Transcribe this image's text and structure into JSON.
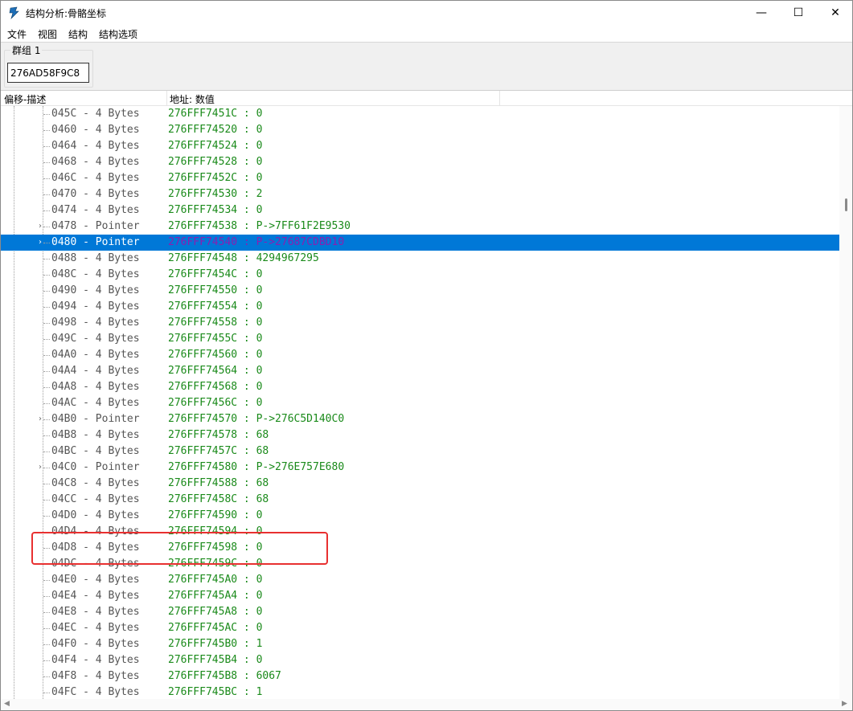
{
  "window": {
    "title": "结构分析:骨骼坐标",
    "min_glyph": "—",
    "max_glyph": "☐",
    "close_glyph": "✕"
  },
  "menu": [
    "文件",
    "视图",
    "结构",
    "结构选项"
  ],
  "group": {
    "label": "群组 1",
    "address": "276AD58F9C8"
  },
  "columns": {
    "offset_desc": "偏移-描述",
    "address_value": "地址: 数值"
  },
  "rows": [
    {
      "offset_desc": "045C - 4 Bytes",
      "address_value": "276FFF7451C : 0",
      "expandable": false,
      "selected": false
    },
    {
      "offset_desc": "0460 - 4 Bytes",
      "address_value": "276FFF74520 : 0",
      "expandable": false,
      "selected": false
    },
    {
      "offset_desc": "0464 - 4 Bytes",
      "address_value": "276FFF74524 : 0",
      "expandable": false,
      "selected": false
    },
    {
      "offset_desc": "0468 - 4 Bytes",
      "address_value": "276FFF74528 : 0",
      "expandable": false,
      "selected": false
    },
    {
      "offset_desc": "046C - 4 Bytes",
      "address_value": "276FFF7452C : 0",
      "expandable": false,
      "selected": false
    },
    {
      "offset_desc": "0470 - 4 Bytes",
      "address_value": "276FFF74530 : 2",
      "expandable": false,
      "selected": false
    },
    {
      "offset_desc": "0474 - 4 Bytes",
      "address_value": "276FFF74534 : 0",
      "expandable": false,
      "selected": false
    },
    {
      "offset_desc": "0478 - Pointer",
      "address_value": "276FFF74538 : P->7FF61F2E9530",
      "expandable": true,
      "selected": false
    },
    {
      "offset_desc": "0480 - Pointer",
      "address_value": "276FFF74540 : P->27687CDBD10",
      "expandable": true,
      "selected": true
    },
    {
      "offset_desc": "0488 - 4 Bytes",
      "address_value": "276FFF74548 : 4294967295",
      "expandable": false,
      "selected": false
    },
    {
      "offset_desc": "048C - 4 Bytes",
      "address_value": "276FFF7454C : 0",
      "expandable": false,
      "selected": false
    },
    {
      "offset_desc": "0490 - 4 Bytes",
      "address_value": "276FFF74550 : 0",
      "expandable": false,
      "selected": false
    },
    {
      "offset_desc": "0494 - 4 Bytes",
      "address_value": "276FFF74554 : 0",
      "expandable": false,
      "selected": false
    },
    {
      "offset_desc": "0498 - 4 Bytes",
      "address_value": "276FFF74558 : 0",
      "expandable": false,
      "selected": false
    },
    {
      "offset_desc": "049C - 4 Bytes",
      "address_value": "276FFF7455C : 0",
      "expandable": false,
      "selected": false
    },
    {
      "offset_desc": "04A0 - 4 Bytes",
      "address_value": "276FFF74560 : 0",
      "expandable": false,
      "selected": false
    },
    {
      "offset_desc": "04A4 - 4 Bytes",
      "address_value": "276FFF74564 : 0",
      "expandable": false,
      "selected": false
    },
    {
      "offset_desc": "04A8 - 4 Bytes",
      "address_value": "276FFF74568 : 0",
      "expandable": false,
      "selected": false
    },
    {
      "offset_desc": "04AC - 4 Bytes",
      "address_value": "276FFF7456C : 0",
      "expandable": false,
      "selected": false
    },
    {
      "offset_desc": "04B0 - Pointer",
      "address_value": "276FFF74570 : P->276C5D140C0",
      "expandable": true,
      "selected": false
    },
    {
      "offset_desc": "04B8 - 4 Bytes",
      "address_value": "276FFF74578 : 68",
      "expandable": false,
      "selected": false
    },
    {
      "offset_desc": "04BC - 4 Bytes",
      "address_value": "276FFF7457C : 68",
      "expandable": false,
      "selected": false
    },
    {
      "offset_desc": "04C0 - Pointer",
      "address_value": "276FFF74580 : P->276E757E680",
      "expandable": true,
      "selected": false
    },
    {
      "offset_desc": "04C8 - 4 Bytes",
      "address_value": "276FFF74588 : 68",
      "expandable": false,
      "selected": false
    },
    {
      "offset_desc": "04CC - 4 Bytes",
      "address_value": "276FFF7458C : 68",
      "expandable": false,
      "selected": false
    },
    {
      "offset_desc": "04D0 - 4 Bytes",
      "address_value": "276FFF74590 : 0",
      "expandable": false,
      "selected": false
    },
    {
      "offset_desc": "04D4 - 4 Bytes",
      "address_value": "276FFF74594 : 0",
      "expandable": false,
      "selected": false
    },
    {
      "offset_desc": "04D8 - 4 Bytes",
      "address_value": "276FFF74598 : 0",
      "expandable": false,
      "selected": false
    },
    {
      "offset_desc": "04DC - 4 Bytes",
      "address_value": "276FFF7459C : 0",
      "expandable": false,
      "selected": false
    },
    {
      "offset_desc": "04E0 - 4 Bytes",
      "address_value": "276FFF745A0 : 0",
      "expandable": false,
      "selected": false
    },
    {
      "offset_desc": "04E4 - 4 Bytes",
      "address_value": "276FFF745A4 : 0",
      "expandable": false,
      "selected": false
    },
    {
      "offset_desc": "04E8 - 4 Bytes",
      "address_value": "276FFF745A8 : 0",
      "expandable": false,
      "selected": false
    },
    {
      "offset_desc": "04EC - 4 Bytes",
      "address_value": "276FFF745AC : 0",
      "expandable": false,
      "selected": false
    },
    {
      "offset_desc": "04F0 - 4 Bytes",
      "address_value": "276FFF745B0 : 1",
      "expandable": false,
      "selected": false
    },
    {
      "offset_desc": "04F4 - 4 Bytes",
      "address_value": "276FFF745B4 : 0",
      "expandable": false,
      "selected": false
    },
    {
      "offset_desc": "04F8 - 4 Bytes",
      "address_value": "276FFF745B8 : 6067",
      "expandable": false,
      "selected": false
    },
    {
      "offset_desc": "04FC - 4 Bytes",
      "address_value": "276FFF745BC : 1",
      "expandable": false,
      "selected": false
    }
  ],
  "colors": {
    "selection": "#0078d7",
    "value_text": "#1a8a1a",
    "selected_value_text": "#8b1fb0",
    "highlight_box": "#e83030"
  }
}
